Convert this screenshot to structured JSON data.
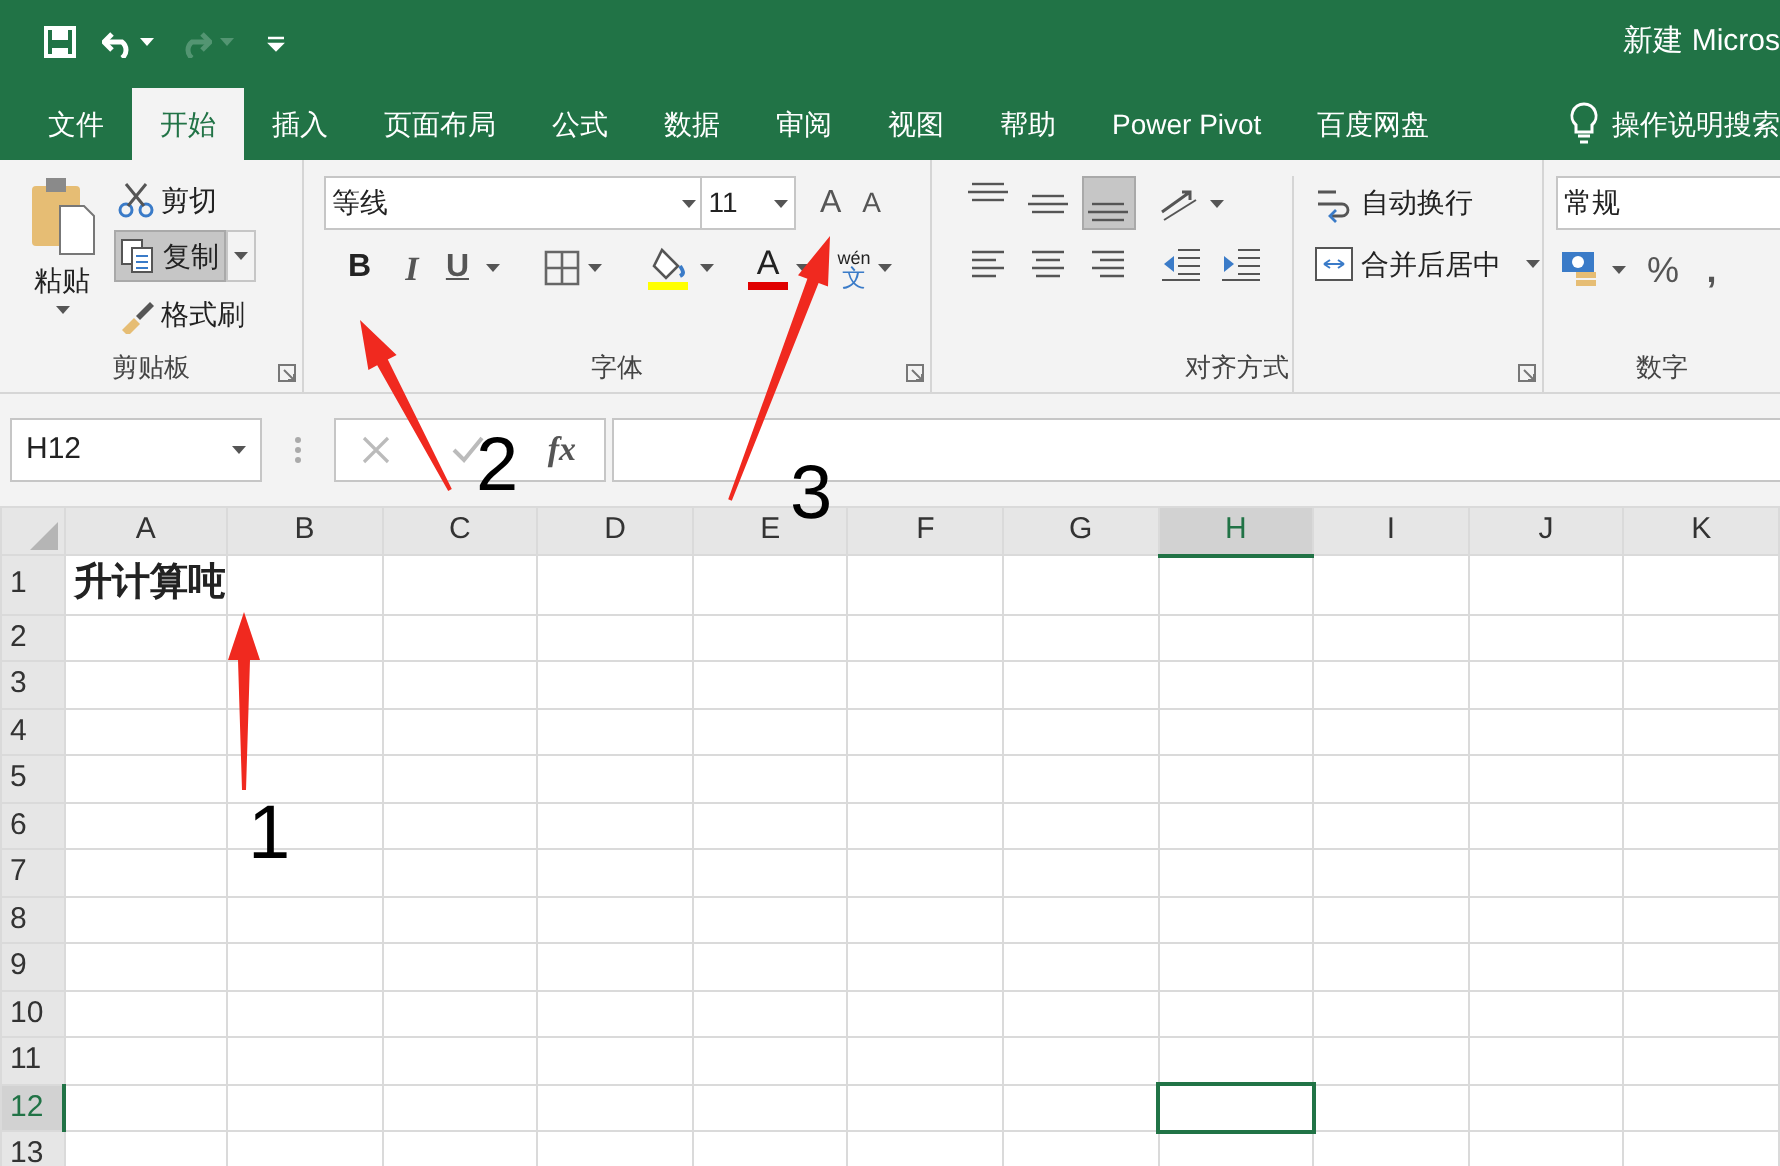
{
  "quick_access": [
    {
      "kind": "save",
      "disabled": false
    },
    {
      "kind": "undo",
      "disabled": false
    },
    {
      "kind": "redo",
      "disabled": true
    },
    {
      "kind": "customize",
      "disabled": false
    }
  ],
  "title": "新建 Micros",
  "tabs": [
    {
      "label": "文件",
      "selected": false
    },
    {
      "label": "开始",
      "selected": true
    },
    {
      "label": "插入",
      "selected": false
    },
    {
      "label": "页面布局",
      "selected": false
    },
    {
      "label": "公式",
      "selected": false
    },
    {
      "label": "数据",
      "selected": false
    },
    {
      "label": "审阅",
      "selected": false
    },
    {
      "label": "视图",
      "selected": false
    },
    {
      "label": "帮助",
      "selected": false
    },
    {
      "label": "Power Pivot",
      "selected": false
    },
    {
      "label": "百度网盘",
      "selected": false
    }
  ],
  "tell_me": "操作说明搜索",
  "ribbon": {
    "clipboard": {
      "paste": "粘贴",
      "cut": "剪切",
      "copy": "复制",
      "format_painter": "格式刷",
      "group_label": "剪贴板"
    },
    "font": {
      "font_name": "等线",
      "font_size": "11",
      "grow": "A",
      "shrink": "A",
      "bold": "B",
      "italic": "I",
      "underline": "U",
      "font_color": "A",
      "phonetic_top": "wén",
      "phonetic_bottom": "文",
      "group_label": "字体"
    },
    "alignment": {
      "vertical": [
        {
          "kind": "top",
          "selected": false
        },
        {
          "kind": "middle",
          "selected": false
        },
        {
          "kind": "bottom",
          "selected": true
        }
      ],
      "wrap_text": "自动换行",
      "merge_center": "合并后居中",
      "group_label": "对齐方式"
    },
    "number": {
      "format": "常规",
      "percent": "%",
      "comma": ",",
      "group_label": "数字"
    }
  },
  "formula_bar": {
    "name_box": "H12",
    "fx": "fx"
  },
  "sheet": {
    "columns": [
      {
        "label": "A",
        "selected": false
      },
      {
        "label": "B",
        "selected": false
      },
      {
        "label": "C",
        "selected": false
      },
      {
        "label": "D",
        "selected": false
      },
      {
        "label": "E",
        "selected": false
      },
      {
        "label": "F",
        "selected": false
      },
      {
        "label": "G",
        "selected": false
      },
      {
        "label": "H",
        "selected": true
      },
      {
        "label": "I",
        "selected": false
      },
      {
        "label": "J",
        "selected": false
      },
      {
        "label": "K",
        "selected": false
      }
    ],
    "rows": [
      {
        "label": "1",
        "selected": false,
        "cells": [
          {
            "text": "升计算吨",
            "bold": true
          }
        ]
      },
      {
        "label": "2",
        "selected": false
      },
      {
        "label": "3",
        "selected": false
      },
      {
        "label": "4",
        "selected": false
      },
      {
        "label": "5",
        "selected": false
      },
      {
        "label": "6",
        "selected": false
      },
      {
        "label": "7",
        "selected": false
      },
      {
        "label": "8",
        "selected": false
      },
      {
        "label": "9",
        "selected": false
      },
      {
        "label": "10",
        "selected": false
      },
      {
        "label": "11",
        "selected": false
      },
      {
        "label": "12",
        "selected": true
      },
      {
        "label": "13",
        "selected": false
      }
    ]
  },
  "annotations": [
    {
      "label": "1"
    },
    {
      "label": "2"
    },
    {
      "label": "3"
    }
  ]
}
